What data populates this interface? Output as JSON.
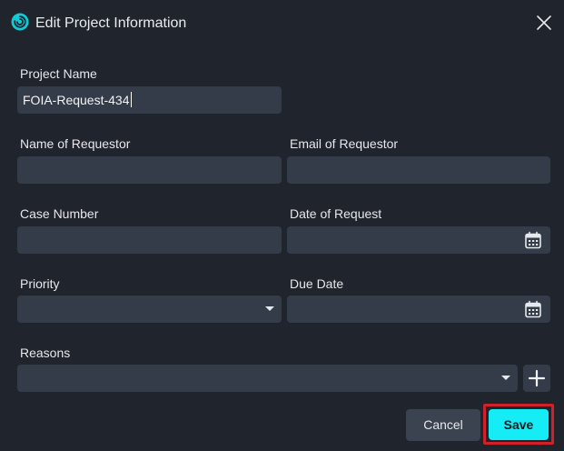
{
  "window": {
    "title": "Edit Project Information",
    "app_icon": "swirl-logo-icon",
    "close_icon": "close-icon"
  },
  "fields": {
    "project_name": {
      "label": "Project Name",
      "value": "FOIA-Request-434"
    },
    "requestor_name": {
      "label": "Name of Requestor",
      "value": ""
    },
    "requestor_email": {
      "label": "Email of Requestor",
      "value": ""
    },
    "case_number": {
      "label": "Case Number",
      "value": ""
    },
    "date_of_request": {
      "label": "Date of Request",
      "value": "",
      "icon": "calendar-icon"
    },
    "priority": {
      "label": "Priority",
      "value": "",
      "icon": "chevron-down-icon"
    },
    "due_date": {
      "label": "Due Date",
      "value": "",
      "icon": "calendar-icon"
    },
    "reasons": {
      "label": "Reasons",
      "value": "",
      "icon": "chevron-down-icon",
      "add_icon": "plus-icon"
    }
  },
  "actions": {
    "cancel_label": "Cancel",
    "save_label": "Save"
  },
  "colors": {
    "background": "#1f242d",
    "field": "#343c4a",
    "accent": "#15ecf5",
    "highlight": "#d0202a"
  }
}
